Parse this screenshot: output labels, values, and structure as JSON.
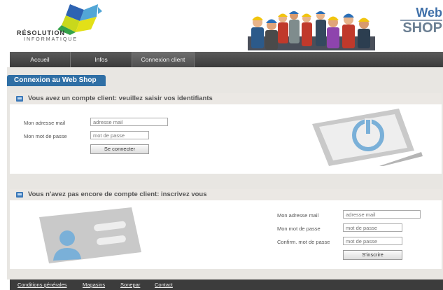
{
  "brand": {
    "name": "RÉSOLUTION",
    "subtitle": "INFORMATIQUE",
    "webshop_line1": "Web",
    "webshop_line2": "SHOP"
  },
  "nav": {
    "items": [
      {
        "label": "Accueil"
      },
      {
        "label": "Infos"
      },
      {
        "label": "Connexion client",
        "active": true
      }
    ]
  },
  "section_title": "Connexion au Web Shop",
  "login": {
    "heading": "Vous avez un compte client: veuillez saisir vos identifiants",
    "email_label": "Mon adresse mail",
    "email_placeholder": "adresse mail",
    "password_label": "Mon mot de passe",
    "password_placeholder": "mot de passe",
    "submit_label": "Se connecter",
    "illustration_icon": "laptop-power-icon"
  },
  "register": {
    "heading": "Vous n'avez pas encore de compte client: inscrivez vous",
    "email_label": "Mon adresse mail",
    "email_placeholder": "adresse mail",
    "password_label": "Mon mot de passe",
    "password_placeholder": "mot de passe",
    "confirm_label": "Confirm. mot de passe",
    "confirm_placeholder": "mot de passe",
    "submit_label": "S'inscrire",
    "illustration_icon": "id-card-icon"
  },
  "footer": {
    "links": [
      {
        "label": "Conditions générales"
      },
      {
        "label": "Magasins"
      },
      {
        "label": "Sonepar"
      },
      {
        "label": "Contact"
      }
    ]
  },
  "colors": {
    "accent_blue": "#2f6fa5",
    "nav_dark": "#3a3a3a",
    "panel_bg": "#e8e6e2"
  }
}
